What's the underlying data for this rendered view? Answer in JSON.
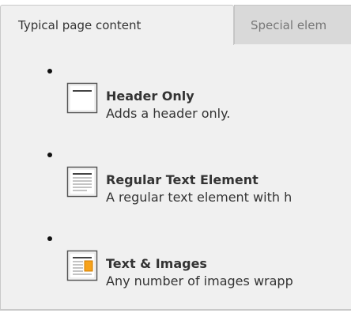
{
  "tabs": [
    {
      "label": "Typical page content",
      "active": true
    },
    {
      "label": "Special elem",
      "active": false
    }
  ],
  "elements": [
    {
      "title": "Header Only",
      "description": "Adds a header only.",
      "icon": "header-only-icon"
    },
    {
      "title": "Regular Text Element",
      "description": "A regular text element with h",
      "icon": "text-element-icon"
    },
    {
      "title": "Text & Images",
      "description": "Any number of images wrapp",
      "icon": "text-images-icon"
    }
  ],
  "colors": {
    "panel_background": "#f0f0f0",
    "inactive_tab": "#d9d9d9",
    "image_accent": "#f7a21b",
    "border": "#c9c9c9"
  }
}
